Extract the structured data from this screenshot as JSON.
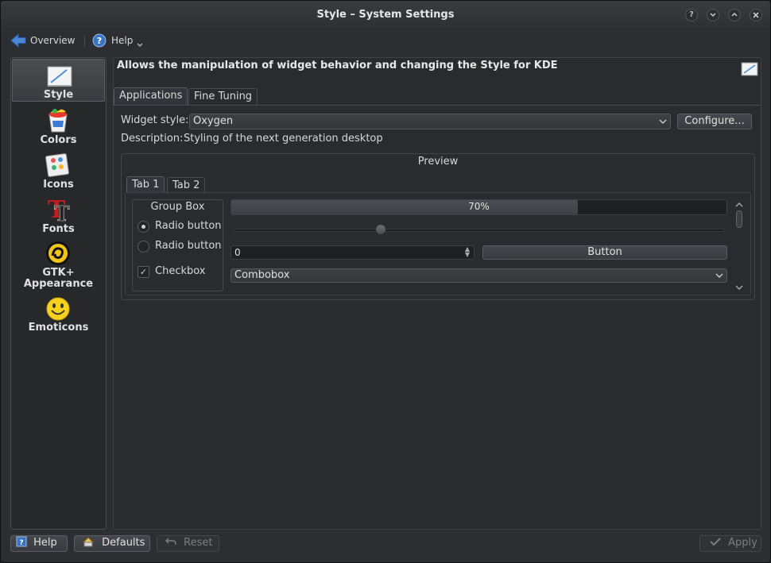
{
  "window": {
    "title": "Style – System Settings",
    "buttons": [
      "?",
      "˅",
      "˄",
      "✕"
    ]
  },
  "toolbar": {
    "overview_label": "Overview",
    "help_label": "Help"
  },
  "sidebar": {
    "items": [
      {
        "label": "Style",
        "icon": "style-icon",
        "selected": true
      },
      {
        "label": "Colors",
        "icon": "colors-icon"
      },
      {
        "label": "Icons",
        "icon": "icons-icon"
      },
      {
        "label": "Fonts",
        "icon": "fonts-icon"
      },
      {
        "label_line1": "GTK+",
        "label_line2": "Appearance",
        "icon": "gtk-icon"
      },
      {
        "label": "Emoticons",
        "icon": "emoticons-icon"
      }
    ]
  },
  "main": {
    "headline": "Allows the manipulation of widget behavior and changing the Style for KDE",
    "tabs": [
      {
        "label": "Applications",
        "active": true
      },
      {
        "label": "Fine Tuning"
      }
    ],
    "widget_style_label": "Widget style:",
    "widget_style_value": "Oxygen",
    "configure_label": "Configure...",
    "description_label": "Description:",
    "description_text": "Styling of the next generation desktop"
  },
  "preview": {
    "title": "Preview",
    "tabs": [
      {
        "label": "Tab 1",
        "active": true
      },
      {
        "label": "Tab 2"
      }
    ],
    "group_box_title": "Group Box",
    "radio1_label": "Radio button",
    "radio2_label": "Radio button",
    "checkbox_label": "Checkbox",
    "radio1_checked": true,
    "checkbox_checked": true,
    "progress_percent": 70,
    "progress_text": "70%",
    "slider_value": 0.3,
    "spin_value": "0",
    "button_label": "Button",
    "combo_value": "Combobox"
  },
  "footer": {
    "help_label": "Help",
    "defaults_label": "Defaults",
    "reset_label": "Reset",
    "apply_label": "Apply"
  },
  "colors": {
    "window_bg": "#2d2e31",
    "accent_blue": "#3b73c4"
  }
}
